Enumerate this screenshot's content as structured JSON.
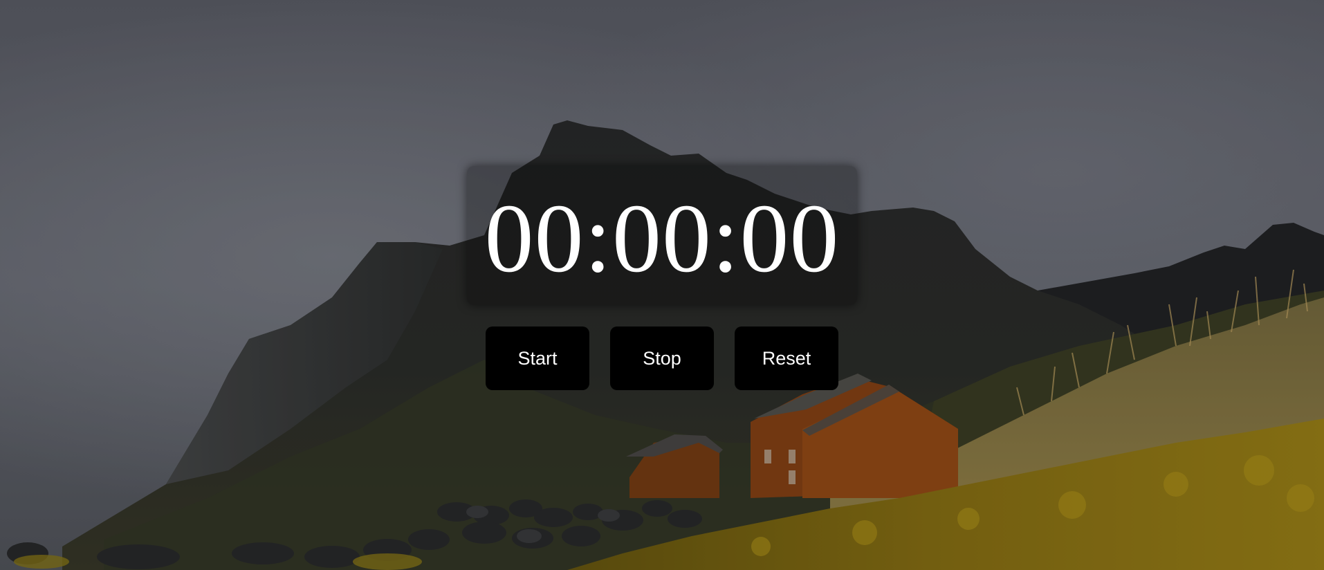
{
  "timer": {
    "display": "00:00:00"
  },
  "controls": {
    "start_label": "Start",
    "stop_label": "Stop",
    "reset_label": "Reset"
  },
  "background": {
    "description_icon": "mountain-landscape-image"
  }
}
